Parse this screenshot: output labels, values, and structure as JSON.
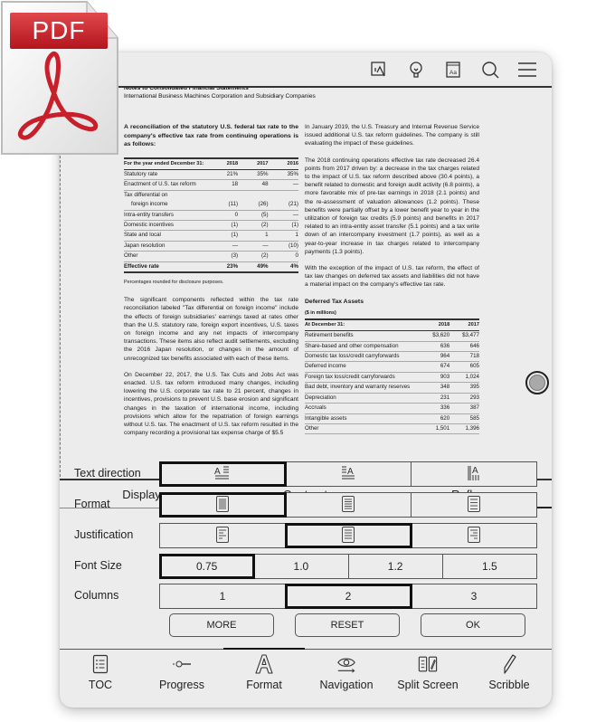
{
  "logo": {
    "label": "PDF",
    "accent": "#c8202a"
  },
  "toolbar": {
    "icons": [
      "touch-mode-icon",
      "light-bulb-icon",
      "dictionary-icon",
      "search-icon",
      "menu-icon"
    ]
  },
  "document": {
    "header_title": "Notes to Consolidated Financial Statements",
    "header_subtitle": "International Business Machines Corporation and Subsidiary Companies",
    "left": {
      "intro": "A reconciliation of the statutory U.S. federal tax rate to the company's effective tax rate from continuing operations is as follows:",
      "table": {
        "headers": [
          "For the year ended December 31:",
          "2018",
          "2017",
          "2016"
        ],
        "rows": [
          [
            "Statutory rate",
            "21%",
            "35%",
            "35%"
          ],
          [
            "Enactment of U.S. tax reform",
            "18",
            "48",
            "—"
          ],
          [
            "Tax differential on",
            "",
            "",
            ""
          ],
          [
            "foreign income",
            "(11)",
            "(26)",
            "(21)"
          ],
          [
            "Intra-entity transfers",
            "0",
            "(5)",
            "—"
          ],
          [
            "Domestic incentives",
            "(1)",
            "(2)",
            "(1)"
          ],
          [
            "State and local",
            "(1)",
            "1",
            "1"
          ],
          [
            "Japan resolution",
            "—",
            "—",
            "(10)"
          ],
          [
            "Other",
            "(3)",
            "(2)",
            "0"
          ]
        ],
        "total": [
          "Effective rate",
          "23%",
          "49%",
          "4%"
        ]
      },
      "footnote": "Percentages rounded for disclosure purposes.",
      "para1": "The significant components reflected within the tax rate reconciliation labeled \"Tax differential on foreign income\" include the effects of foreign subsidiaries' earnings taxed at rates other than the U.S. statutory rate, foreign export incentives, U.S. taxes on foreign income and any net impacts of intercompany transactions. These items also reflect audit settlements, excluding the 2016 Japan resolution, or changes in the amount of unrecognized tax benefits associated with each of these items.",
      "para2": "On December 22, 2017, the U.S. Tax Cuts and Jobs Act was enacted. U.S. tax reform introduced many changes, including lowering the U.S. corporate tax rate to 21 percent, changes in incentives, provisions to prevent U.S. base erosion and significant changes in the taxation of international income, including provisions which allow for the repatriation of foreign earnings without U.S. tax. The enactment of U.S. tax reform resulted in the company recording a provisional tax expense charge of $5.5"
    },
    "right": {
      "para1": "In January 2019, the U.S. Treasury and Internal Revenue Service issued additional U.S. tax reform guidelines. The company is still evaluating the impact of these guidelines.",
      "para2": "The 2018 continuing operations effective tax rate decreased 26.4 points from 2017 driven by: a decrease in the tax charges related to the impact of U.S. tax reform described above (30.4 points), a benefit related to domestic and foreign audit activity (6.8 points), a more favorable mix of pre-tax earnings in 2018 (2.1 points) and the re-assessment of valuation allowances (1.2 points). These benefits were partially offset by a lower benefit year to year in the utilization of foreign tax credits (5.9 points) and benefits in 2017 related to an intra-entity asset transfer (5.1 points) and a tax write down of an intercompany investment (1.7 points), as well as a year-to-year increase in tax charges related to intercompany payments (1.3 points).",
      "para3": "With the exception of the impact of U.S. tax reform, the effect of tax law changes on deferred tax assets and liabilities did not have a material impact on the company's effective tax rate.",
      "section_title": "Deferred Tax Assets",
      "units": "($ in millions)",
      "table": {
        "headers": [
          "At December 31:",
          "2018",
          "2017"
        ],
        "rows": [
          [
            "Retirement benefits",
            "$3,620",
            "$3,477"
          ],
          [
            "Share-based and other compensation",
            "636",
            "646"
          ],
          [
            "Domestic tax loss/credit carryforwards",
            "964",
            "718"
          ],
          [
            "Deferred income",
            "674",
            "605"
          ],
          [
            "Foreign tax loss/credit carryforwards",
            "903",
            "1,024"
          ],
          [
            "Bad debt, inventory and warranty reserves",
            "348",
            "395"
          ],
          [
            "Depreciation",
            "231",
            "293"
          ],
          [
            "Accruals",
            "336",
            "387"
          ],
          [
            "Intangible assets",
            "620",
            "585"
          ],
          [
            "Other",
            "1,501",
            "1,396"
          ]
        ]
      }
    }
  },
  "tabs": [
    {
      "label": "Display",
      "active": false
    },
    {
      "label": "Contrast",
      "active": false
    },
    {
      "label": "Reflow",
      "active": true
    }
  ],
  "settings": {
    "text_direction": {
      "label": "Text direction",
      "options": [
        "horizontal-left-icon",
        "horizontal-right-icon",
        "vertical-icon"
      ],
      "selected": 0
    },
    "format": {
      "label": "Format",
      "options": [
        "format-dense-icon",
        "format-medium-icon",
        "format-loose-icon"
      ],
      "selected": 0
    },
    "justification": {
      "label": "Justification",
      "options": [
        "align-left-icon",
        "align-justify-icon",
        "align-right-icon"
      ],
      "selected": 1
    },
    "font_size": {
      "label": "Font Size",
      "options": [
        "0.75",
        "1.0",
        "1.2",
        "1.5"
      ],
      "selected": 0
    },
    "columns": {
      "label": "Columns",
      "options": [
        "1",
        "2",
        "3"
      ],
      "selected": 1
    }
  },
  "actions": {
    "more": "MORE",
    "reset": "RESET",
    "ok": "OK"
  },
  "bottom_nav": [
    {
      "label": "TOC",
      "icon": "toc-icon"
    },
    {
      "label": "Progress",
      "icon": "progress-icon"
    },
    {
      "label": "Format",
      "icon": "format-icon",
      "active": true
    },
    {
      "label": "Navigation",
      "icon": "navigation-icon"
    },
    {
      "label": "Split Screen",
      "icon": "split-screen-icon"
    },
    {
      "label": "Scribble",
      "icon": "scribble-icon"
    }
  ]
}
